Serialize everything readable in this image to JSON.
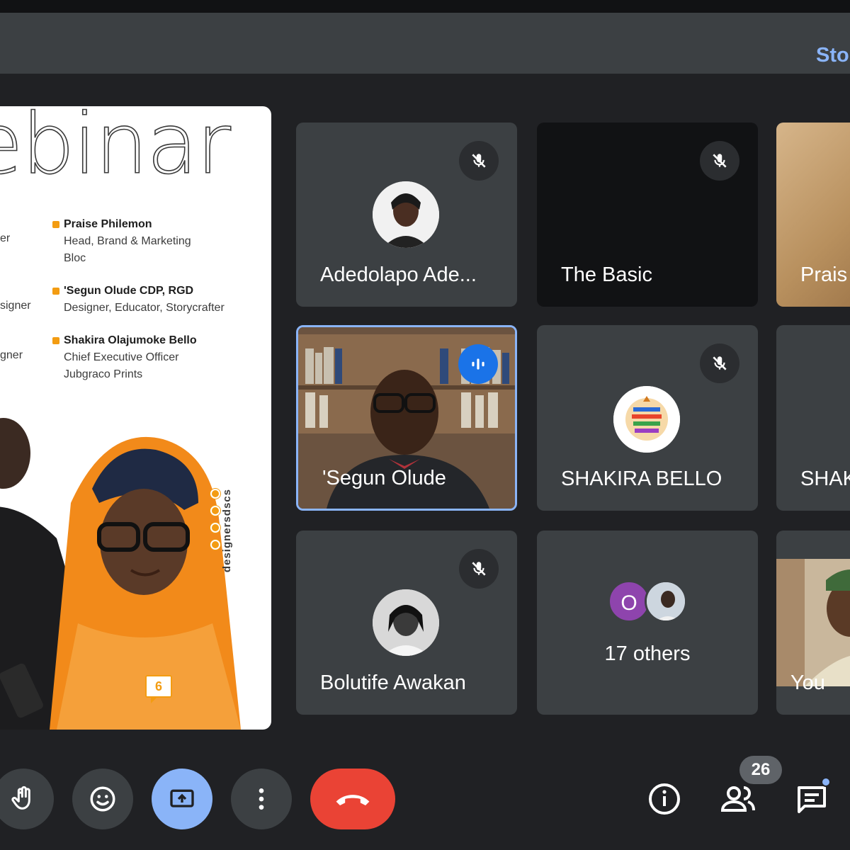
{
  "banner": {
    "link_text": "Sto"
  },
  "slide": {
    "title": "ebinar",
    "fragments": [
      "er",
      "signer",
      "gner"
    ],
    "speakers": [
      {
        "name": "Praise Philemon",
        "lines": [
          "Head, Brand & Marketing",
          "Bloc"
        ]
      },
      {
        "name": "'Segun Olude CDP, RGD",
        "lines": [
          "Designer, Educator, Storycrafter"
        ]
      },
      {
        "name": "Shakira Olajumoke Bello",
        "lines": [
          "Chief Executive Officer",
          "Jubgraco Prints"
        ]
      }
    ],
    "social_handle": "designersdscs",
    "page_number": "6"
  },
  "tiles": {
    "t1": {
      "name": "Adedolapo Ade..."
    },
    "t2": {
      "name": "The Basic"
    },
    "t3": {
      "name": "Prais"
    },
    "t4": {
      "name": "'Segun Olude"
    },
    "t5": {
      "name": "SHAKIRA BELLO"
    },
    "t6": {
      "name": "SHAK"
    },
    "t7": {
      "name": "Bolutife Awakan"
    },
    "t8": {
      "initial": "O",
      "others": "17 others"
    },
    "t9": {
      "name": "You"
    }
  },
  "controls": {
    "participant_count": "26"
  },
  "colors": {
    "background": "#202124",
    "tile": "#3c4043",
    "accent": "#8ab4f8",
    "hangup": "#ea4335",
    "speaking": "#1a73e8",
    "slide_accent": "#f39c12"
  }
}
